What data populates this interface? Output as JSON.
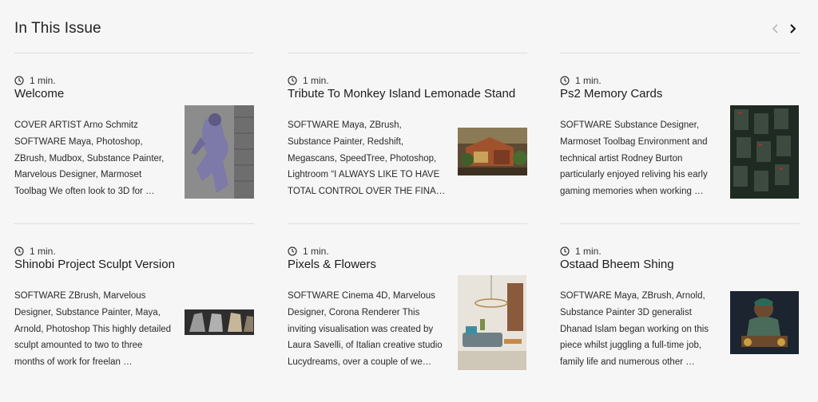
{
  "header": {
    "title": "In This Issue"
  },
  "nav": {
    "prev_icon": "chevron-left-icon",
    "next_icon": "chevron-right-icon"
  },
  "cards": [
    {
      "read_time": "1 min.",
      "title": "Welcome",
      "excerpt": "COVER ARTIST Arno Schmitz SOFTWARE Maya, Photoshop, ZBrush, Mudbox, Substance Painter, Marvelous Designer, Marmoset Toolbag We often look to 3D for …"
    },
    {
      "read_time": "1 min.",
      "title": "Tribute To Monkey Island Lemonade Stand",
      "excerpt": "SOFTWARE Maya, ZBrush, Substance Painter, Redshift, Megascans, SpeedTree, Photoshop, Lightroom “I ALWAYS LIKE TO HAVE TOTAL CONTROL OVER THE FINAL RES…"
    },
    {
      "read_time": "1 min.",
      "title": "Ps2 Memory Cards",
      "excerpt": "SOFTWARE Substance Designer, Marmoset Toolbag Environment and technical artist Rodney Burton particularly enjoyed reliving his early gaming memories when working …"
    },
    {
      "read_time": "1 min.",
      "title": "Shinobi Project Sculpt Version",
      "excerpt": "SOFTWARE ZBrush, Marvelous Designer, Substance Painter, Maya, Arnold, Photoshop This highly detailed sculpt amounted to two to three months of work for freelan …"
    },
    {
      "read_time": "1 min.",
      "title": "Pixels & Flowers",
      "excerpt": "SOFTWARE Cinema 4D, Marvelous Designer, Corona Renderer This inviting visualisation was created by Laura Savelli, of Italian creative studio Lucydreams, over a couple of we…"
    },
    {
      "read_time": "1 min.",
      "title": "Ostaad Bheem Shing",
      "excerpt": "SOFTWARE Maya, ZBrush, Arnold, Substance Painter 3D generalist Dhanad Islam began working on this piece whilst juggling a full-time job, family life and numerous other …"
    }
  ],
  "colors": {
    "background": "#f6f6f6",
    "divider": "#dedede",
    "text": "#1c1c1c"
  }
}
